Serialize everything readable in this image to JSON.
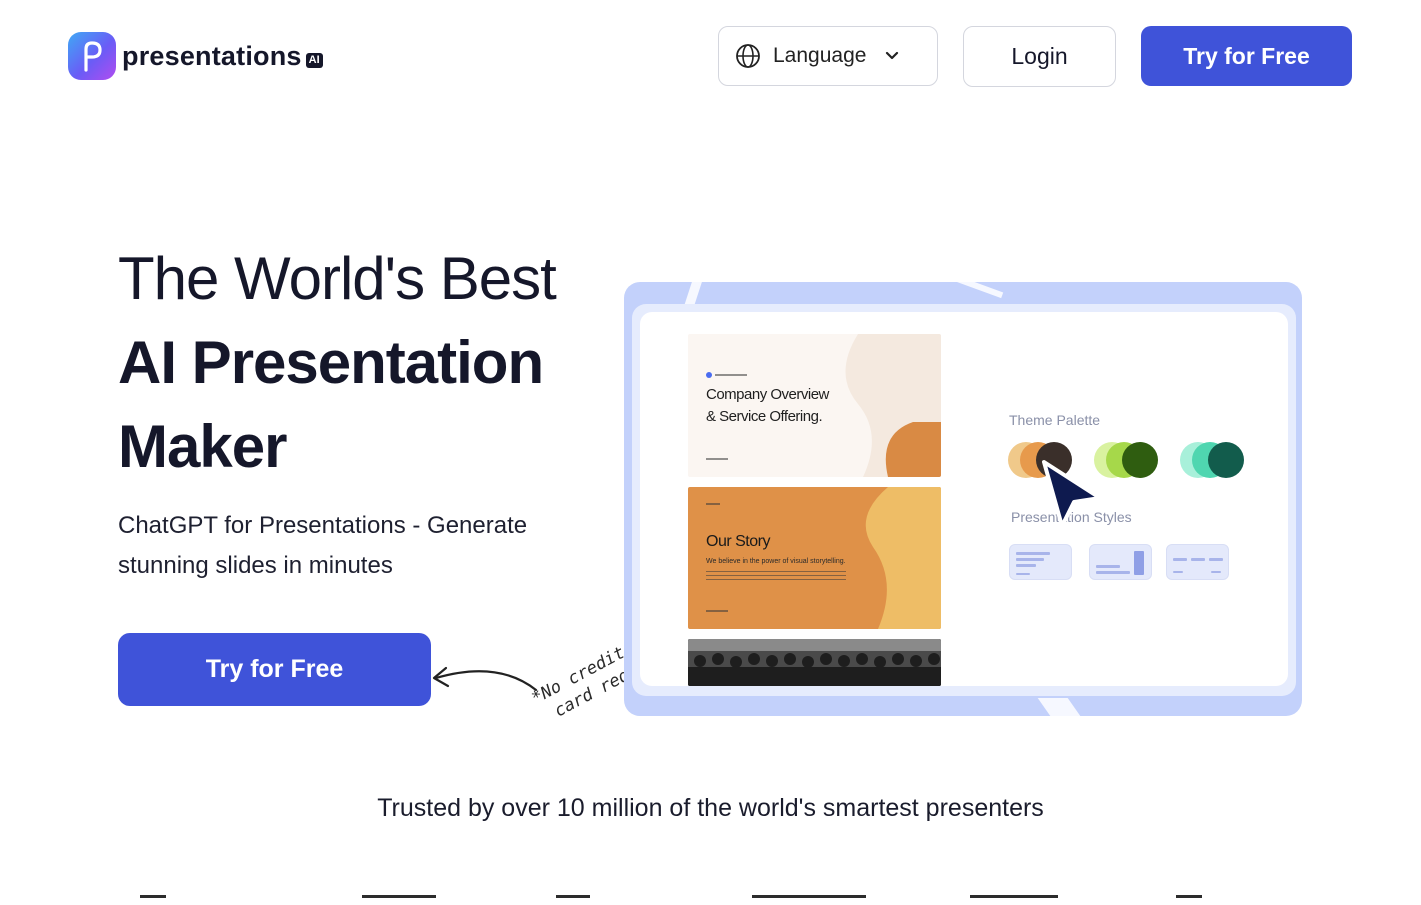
{
  "header": {
    "logo_text": "presentations",
    "logo_badge": "AI",
    "language_label": "Language",
    "login_label": "Login",
    "try_label": "Try for Free"
  },
  "hero": {
    "title_line1": "The World's Best",
    "title_line2": "AI Presentation",
    "title_line3": "Maker",
    "subtitle": "ChatGPT for Presentations - Generate stunning slides in minutes",
    "cta_label": "Try for Free",
    "note_line1": "*No credit",
    "note_line2": "card required"
  },
  "demo": {
    "slide1_title_line1": "Company Overview",
    "slide1_title_line2": "& Service Offering.",
    "slide2_title": "Our Story",
    "slide2_subtitle": "We believe in the power of visual storytelling.",
    "theme_palette_label": "Theme Palette",
    "presentation_styles_label": "Presentation Styles",
    "palettes": [
      [
        "#f0c98a",
        "#e79a4c",
        "#3a2f2a"
      ],
      [
        "#d9f2a0",
        "#a6d84a",
        "#2f5d10"
      ],
      [
        "#a8f0da",
        "#4fd6b0",
        "#125c4c"
      ]
    ]
  },
  "trusted_text": "Trusted by over 10 million of the world's smartest presenters",
  "colors": {
    "primary": "#3f53d9",
    "text_dark": "#15172a",
    "panel": "#c3d1fb"
  }
}
